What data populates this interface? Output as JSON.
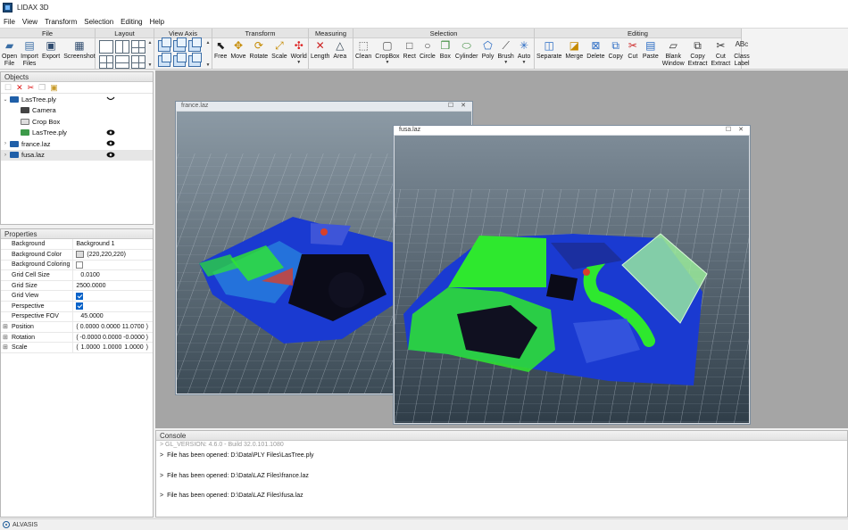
{
  "app": {
    "title": "LIDAX 3D"
  },
  "menu": [
    "File",
    "View",
    "Transform",
    "Selection",
    "Editing",
    "Help"
  ],
  "ribbon": {
    "file": {
      "title": "File",
      "tools": [
        {
          "label": "Open\nFile",
          "icon": "folder-open-icon"
        },
        {
          "label": "Import\nFiles",
          "icon": "import-files-icon"
        },
        {
          "label": "Export",
          "icon": "save-icon"
        },
        {
          "label": "Screenshot",
          "icon": "screenshot-icon"
        }
      ]
    },
    "layout": {
      "title": "Layout"
    },
    "view_axis": {
      "title": "View Axis"
    },
    "transform": {
      "title": "Transform",
      "tools": [
        {
          "label": "Free",
          "icon": "cursor-icon"
        },
        {
          "label": "Move",
          "icon": "move-icon"
        },
        {
          "label": "Rotate",
          "icon": "rotate-icon"
        },
        {
          "label": "Scale",
          "icon": "scale-icon"
        },
        {
          "label": "World",
          "icon": "world-axis-icon",
          "dropdown": true
        }
      ]
    },
    "measuring": {
      "title": "Measuring",
      "tools": [
        {
          "label": "Length",
          "icon": "length-icon"
        },
        {
          "label": "Area",
          "icon": "area-icon"
        }
      ]
    },
    "selection": {
      "title": "Selection",
      "tools": [
        {
          "label": "Clean",
          "icon": "clean-icon"
        },
        {
          "label": "CropBox",
          "icon": "cropbox-icon",
          "dropdown": true
        },
        {
          "label": "Rect",
          "icon": "rect-select-icon"
        },
        {
          "label": "Circle",
          "icon": "circle-select-icon"
        },
        {
          "label": "Box",
          "icon": "box-select-icon"
        },
        {
          "label": "Cylinder",
          "icon": "cylinder-select-icon"
        },
        {
          "label": "Poly",
          "icon": "poly-select-icon"
        },
        {
          "label": "Brush",
          "icon": "brush-icon",
          "dropdown": true
        },
        {
          "label": "Auto",
          "icon": "auto-select-icon",
          "dropdown": true
        }
      ]
    },
    "editing": {
      "title": "Editing",
      "tools": [
        {
          "label": "Separate",
          "icon": "separate-icon"
        },
        {
          "label": "Merge",
          "icon": "merge-icon"
        },
        {
          "label": "Delete",
          "icon": "delete-icon"
        },
        {
          "label": "Copy",
          "icon": "copy-icon"
        },
        {
          "label": "Cut",
          "icon": "cut-icon"
        },
        {
          "label": "Paste",
          "icon": "paste-icon"
        },
        {
          "label": "Blank\nWindow",
          "icon": "blank-window-icon"
        },
        {
          "label": "Copy\nExtract",
          "icon": "copy-extract-icon"
        },
        {
          "label": "Cut\nExtract",
          "icon": "cut-extract-icon"
        },
        {
          "label": "Class\nLabel",
          "icon": "class-label-icon"
        }
      ]
    }
  },
  "objects": {
    "title": "Objects",
    "items": [
      {
        "label": "LasTree.ply",
        "level": 0,
        "expanded": true,
        "visible": "partial"
      },
      {
        "label": "Camera",
        "level": 1
      },
      {
        "label": "Crop Box",
        "level": 1
      },
      {
        "label": "LasTree.ply",
        "level": 1,
        "visible": true
      },
      {
        "label": "france.laz",
        "level": 0,
        "expanded": false,
        "visible": true
      },
      {
        "label": "fusa.laz",
        "level": 0,
        "expanded": false,
        "visible": true,
        "selected": true
      }
    ]
  },
  "properties": {
    "title": "Properties",
    "rows": {
      "background": {
        "key": "Background",
        "value": "Background 1"
      },
      "background_color": {
        "key": "Background Color",
        "value": "(220,220,220)"
      },
      "background_coloring": {
        "key": "Background Coloring",
        "checked": false
      },
      "grid_cell_size": {
        "key": "Grid Cell Size",
        "value": "0.0100"
      },
      "grid_size": {
        "key": "Grid Size",
        "value": "2500.0000"
      },
      "grid_view": {
        "key": "Grid View",
        "checked": true
      },
      "perspective": {
        "key": "Perspective",
        "checked": true
      },
      "perspective_fov": {
        "key": "Perspective FOV",
        "value": "45.0000"
      },
      "position": {
        "key": "Position",
        "v": [
          "0.0000",
          "0.0000",
          "11.0700"
        ]
      },
      "rotation": {
        "key": "Rotation",
        "v": [
          "-0.0000",
          "0.0000",
          "-0.0000"
        ]
      },
      "scale": {
        "key": "Scale",
        "v": [
          "1.0000",
          "1.0000",
          "1.0000"
        ]
      }
    }
  },
  "windows": {
    "france": {
      "title": "france.laz"
    },
    "fusa": {
      "title": "fusa.laz"
    }
  },
  "console": {
    "title": "Console",
    "lines": [
      "> GL_VERSION: 4.6.0 - Build 32.0.101.1080",
      "File has been opened: D:\\Data\\PLY Files\\LasTree.ply",
      "File has been opened: D:\\Data\\LAZ Files\\france.laz",
      "File has been opened: D:\\Data\\LAZ Files\\fusa.laz"
    ]
  },
  "status": {
    "text": "ALVASIS"
  },
  "colors": {
    "accent": "#0a63c9",
    "viewport_bg": "#5a6b78",
    "point_blue": "#1a3ad1",
    "point_green": "#2ee82e"
  }
}
